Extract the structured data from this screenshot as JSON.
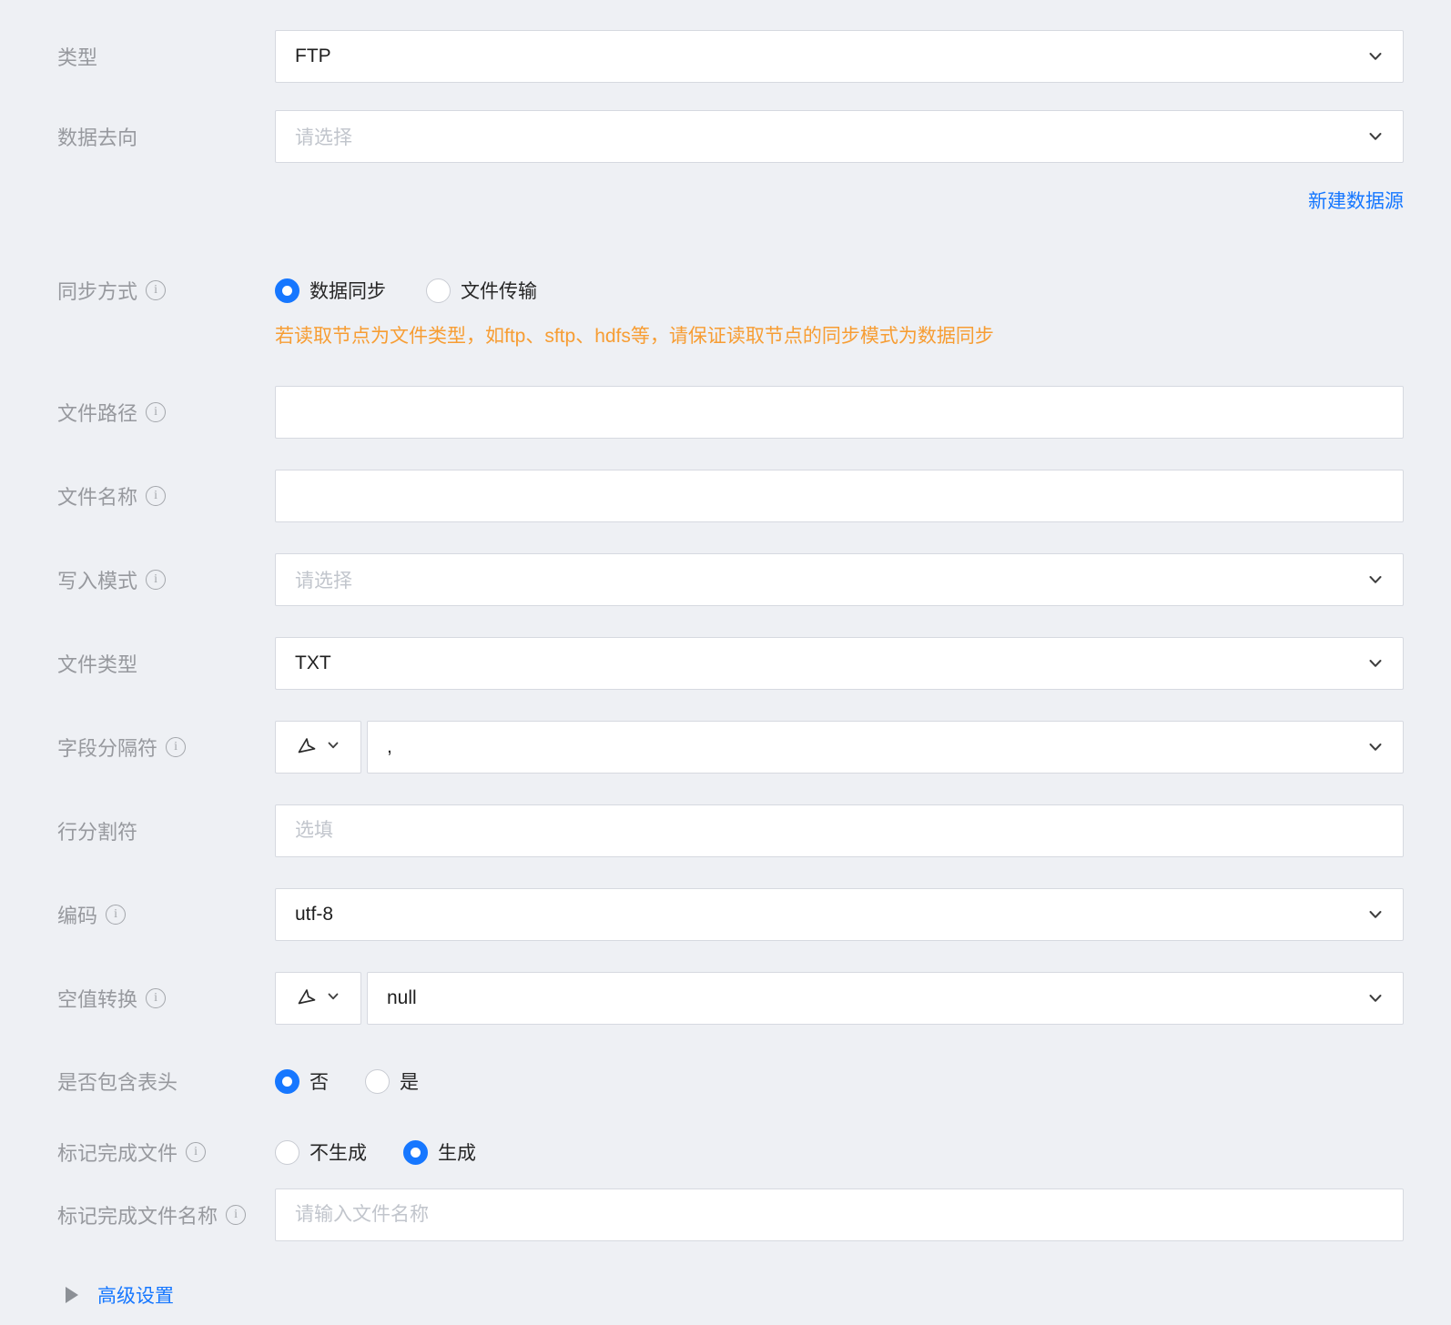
{
  "colors": {
    "background": "#eef0f4",
    "accent_blue": "#1677ff",
    "warning_orange": "#f79d33",
    "label_gray": "#97999e",
    "field_border": "#d6d9e0"
  },
  "icons": {
    "info": "i",
    "chevron_down": "chevron-down",
    "cursor": "cursor-pointer",
    "triangle_right": "triangle-right"
  },
  "form": {
    "type": {
      "label": "类型",
      "value": "FTP"
    },
    "destination": {
      "label": "数据去向",
      "placeholder": "请选择"
    },
    "new_datasource_link": "新建数据源",
    "sync_mode": {
      "label": "同步方式",
      "options": [
        "数据同步",
        "文件传输"
      ],
      "selected": "数据同步",
      "warning": "若读取节点为文件类型，如ftp、sftp、hdfs等，请保证读取节点的同步模式为数据同步"
    },
    "file_path": {
      "label": "文件路径",
      "value": ""
    },
    "file_name": {
      "label": "文件名称",
      "value": ""
    },
    "write_mode": {
      "label": "写入模式",
      "placeholder": "请选择"
    },
    "file_type": {
      "label": "文件类型",
      "value": "TXT"
    },
    "field_separator": {
      "label": "字段分隔符",
      "value": ","
    },
    "line_separator": {
      "label": "行分割符",
      "placeholder": "选填"
    },
    "encoding": {
      "label": "编码",
      "value": "utf-8"
    },
    "null_conversion": {
      "label": "空值转换",
      "value": "null"
    },
    "include_header": {
      "label": "是否包含表头",
      "options": [
        "否",
        "是"
      ],
      "selected": "否"
    },
    "mark_done_file": {
      "label": "标记完成文件",
      "options": [
        "不生成",
        "生成"
      ],
      "selected": "生成"
    },
    "mark_done_file_name": {
      "label": "标记完成文件名称",
      "placeholder": "请输入文件名称"
    },
    "advanced_settings": "高级设置"
  }
}
